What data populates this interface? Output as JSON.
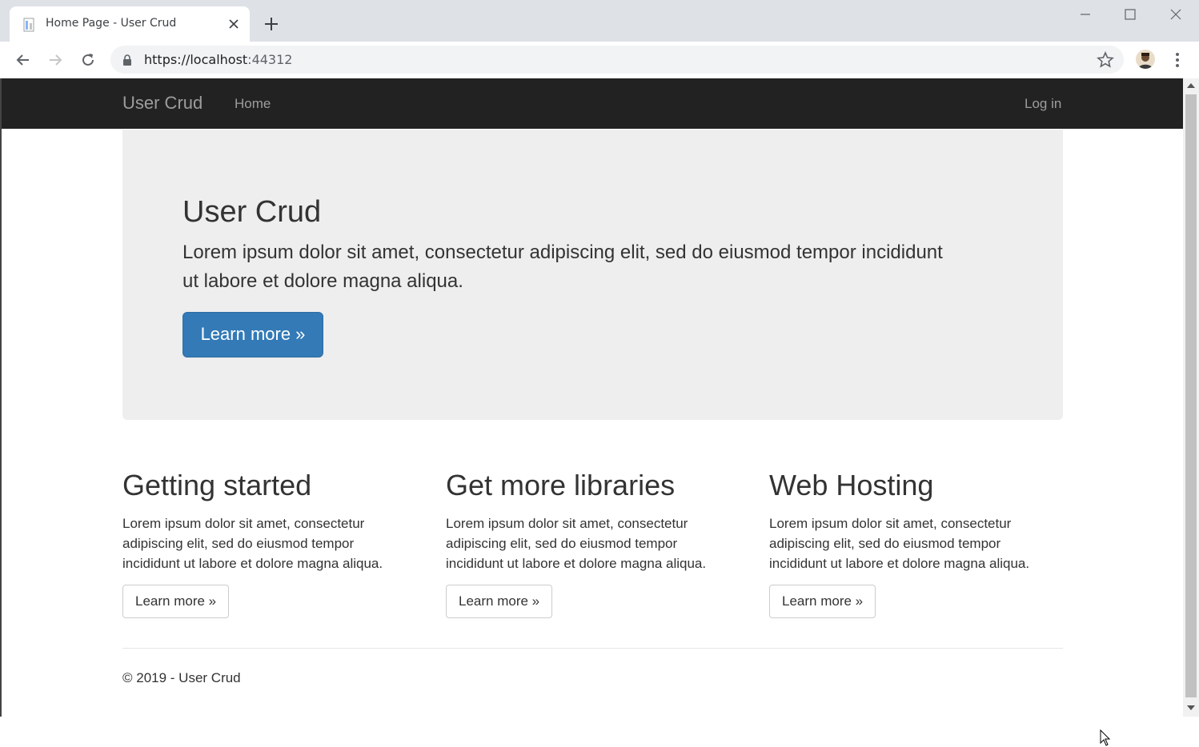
{
  "browser": {
    "tab_title": "Home Page - User Crud",
    "url_host": "https://localhost",
    "url_port": ":44312"
  },
  "navbar": {
    "brand": "User Crud",
    "home": "Home",
    "login": "Log in"
  },
  "jumbotron": {
    "title": "User Crud",
    "text": "Lorem ipsum dolor sit amet, consectetur adipiscing elit, sed do eiusmod tempor incididunt ut labore et dolore magna aliqua.",
    "button": "Learn more »"
  },
  "columns": [
    {
      "title": "Getting started",
      "text": "Lorem ipsum dolor sit amet, consectetur adipiscing elit, sed do eiusmod tempor incididunt ut labore et dolore magna aliqua.",
      "button": "Learn more »"
    },
    {
      "title": "Get more libraries",
      "text": "Lorem ipsum dolor sit amet, consectetur adipiscing elit, sed do eiusmod tempor incididunt ut labore et dolore magna aliqua.",
      "button": "Learn more »"
    },
    {
      "title": "Web Hosting",
      "text": "Lorem ipsum dolor sit amet, consectetur adipiscing elit, sed do eiusmod tempor incididunt ut labore et dolore magna aliqua.",
      "button": "Learn more »"
    }
  ],
  "footer": {
    "text": "© 2019 - User Crud"
  },
  "colors": {
    "navbar_bg": "#222222",
    "jumbotron_bg": "#eeeeee",
    "primary_button": "#337ab7"
  }
}
